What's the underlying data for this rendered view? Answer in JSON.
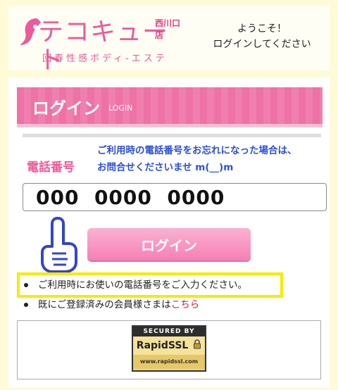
{
  "header": {
    "logo": {
      "shop_name": "西川口店",
      "brand": "テコキュート",
      "tagline": "回春性感ボディ-エステ"
    },
    "welcome": {
      "line1": "ようこそ！",
      "line2": "ログインしてください"
    }
  },
  "login": {
    "title": "ログイン",
    "title_en": "LOGIN",
    "phone_label": "電話番号",
    "notice_line1": "ご利用時の電話番号をお忘れになった場合は、",
    "notice_line2": "お問合せくださいませ m(__)m",
    "phone_value": "000  0000  0000",
    "button_label": "ログイン",
    "pointer_icon": "pointing-hand-icon"
  },
  "notes": {
    "item1": "ご利用時にお使いの電話番号をご入力ください。",
    "item2_prefix": "既にご登録済みの会員様さまは",
    "item2_link": "こちら"
  },
  "ssl_badge": {
    "top": "SECURED BY",
    "brand": "RapidSSL",
    "url": "www.rapidssl.com",
    "icon": "padlock-icon"
  },
  "colors": {
    "accent_pink": "#ee5b98",
    "notice_blue": "#2b50d6",
    "highlight_yellow": "#f5ec00",
    "link_red": "#d8222a",
    "page_bg": "#fffbd9"
  }
}
